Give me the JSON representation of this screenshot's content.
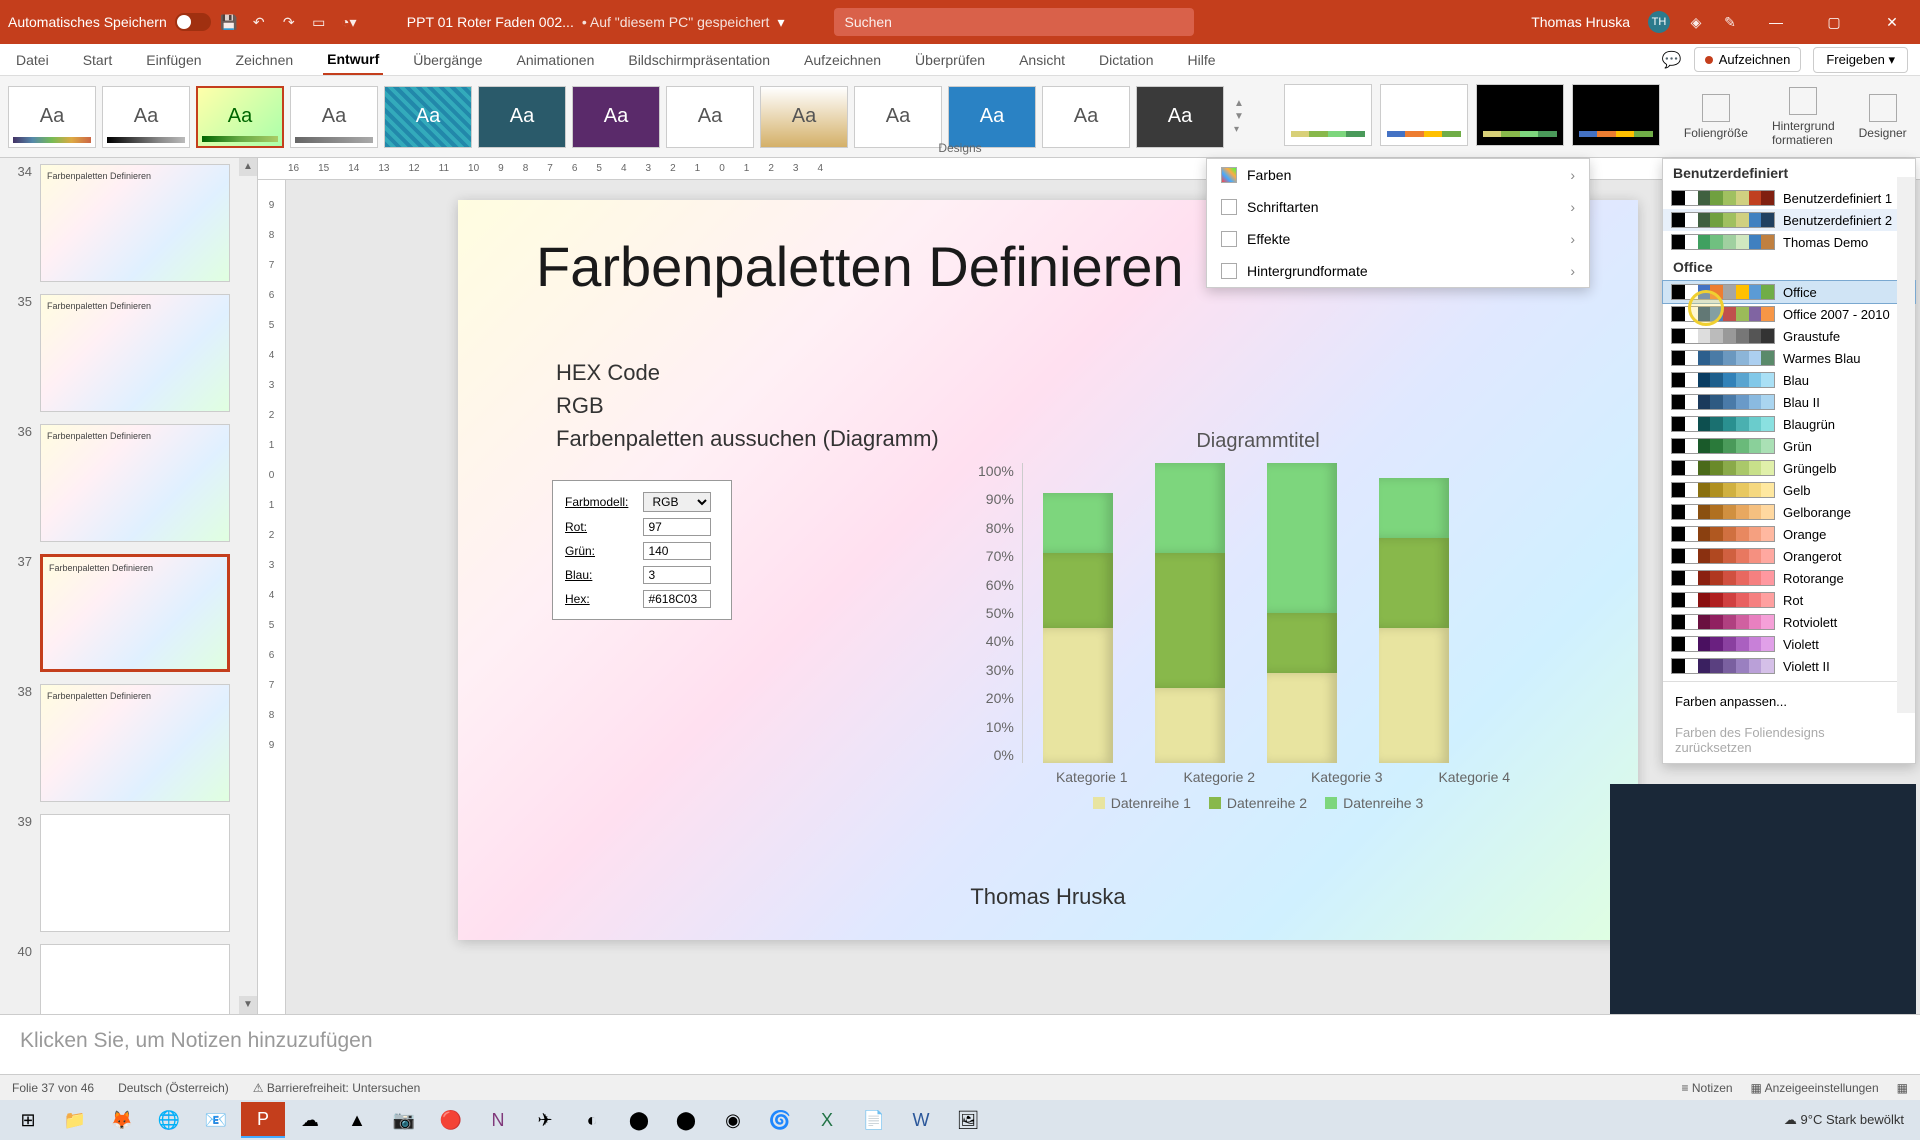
{
  "titlebar": {
    "autosave": "Automatisches Speichern",
    "filename": "PPT 01 Roter Faden 002...",
    "saved_location": "• Auf \"diesem PC\" gespeichert",
    "search_placeholder": "Suchen",
    "user": "Thomas Hruska",
    "initials": "TH"
  },
  "ribbon_tabs": [
    "Datei",
    "Start",
    "Einfügen",
    "Zeichnen",
    "Entwurf",
    "Übergänge",
    "Animationen",
    "Bildschirmpräsentation",
    "Aufzeichnen",
    "Überprüfen",
    "Ansicht",
    "Dictation",
    "Hilfe"
  ],
  "ribbon_active": "Entwurf",
  "ribbon_actions": {
    "record": "Aufzeichnen",
    "share": "Freigeben"
  },
  "designs_label": "Designs",
  "ribbon_right": {
    "slide_size": "Foliengröße",
    "format_bg": "Hintergrund formatieren",
    "designer": "Designer"
  },
  "variant_menu": {
    "colors": "Farben",
    "fonts": "Schriftarten",
    "effects": "Effekte",
    "bg_formats": "Hintergrundformate"
  },
  "colors_flyout": {
    "custom_header": "Benutzerdefiniert",
    "custom": [
      "Benutzerdefiniert 1",
      "Benutzerdefiniert 2",
      "Thomas Demo"
    ],
    "office_header": "Office",
    "office": [
      "Office",
      "Office 2007 - 2010",
      "Graustufe",
      "Warmes Blau",
      "Blau",
      "Blau II",
      "Blaugrün",
      "Grün",
      "Grüngelb",
      "Gelb",
      "Gelborange",
      "Orange",
      "Orangerot",
      "Rotorange",
      "Rot",
      "Rotviolett",
      "Violett",
      "Violett II"
    ],
    "customize": "Farben anpassen...",
    "reset": "Farben des Foliendesigns zurücksetzen"
  },
  "thumbnails": [
    34,
    35,
    36,
    37,
    38,
    39,
    40
  ],
  "thumb_selected": 37,
  "thumb_title": "Farbenpaletten Definieren",
  "ruler_h": [
    16,
    15,
    14,
    13,
    12,
    11,
    10,
    9,
    8,
    7,
    6,
    5,
    4,
    3,
    2,
    1,
    0,
    1,
    2,
    3,
    4
  ],
  "ruler_v": [
    9,
    8,
    7,
    6,
    5,
    4,
    3,
    2,
    1,
    0,
    1,
    2,
    3,
    4,
    5,
    6,
    7,
    8,
    9
  ],
  "slide": {
    "title": "Farbenpaletten Definieren",
    "bullets": [
      "HEX Code",
      "RGB",
      "Farbenpaletten aussuchen (Diagramm)"
    ],
    "author": "Thomas Hruska",
    "colorbox": {
      "model_label": "Farbmodell:",
      "model": "RGB",
      "rot_lbl": "Rot:",
      "rot": "97",
      "gruen_lbl": "Grün:",
      "gruen": "140",
      "blau_lbl": "Blau:",
      "blau": "3",
      "hex_lbl": "Hex:",
      "hex": "#618C03"
    }
  },
  "chart_data": {
    "type": "bar",
    "title": "Diagrammtitel",
    "categories": [
      "Kategorie 1",
      "Kategorie 2",
      "Kategorie 3",
      "Kategorie 4"
    ],
    "series": [
      {
        "name": "Datenreihe 1",
        "values": [
          45,
          25,
          30,
          45
        ],
        "color": "#e8e4a0"
      },
      {
        "name": "Datenreihe 2",
        "values": [
          25,
          45,
          20,
          30
        ],
        "color": "#88b84b"
      },
      {
        "name": "Datenreihe 3",
        "values": [
          20,
          30,
          50,
          20
        ],
        "color": "#7dd67d"
      }
    ],
    "ylabels": [
      "100%",
      "90%",
      "80%",
      "70%",
      "60%",
      "50%",
      "40%",
      "30%",
      "20%",
      "10%",
      "0%"
    ],
    "ylim": [
      0,
      100
    ]
  },
  "notes_placeholder": "Klicken Sie, um Notizen hinzuzufügen",
  "statusbar": {
    "slide": "Folie 37 von 46",
    "lang": "Deutsch (Österreich)",
    "access": "Barrierefreiheit: Untersuchen",
    "notes": "Notizen",
    "display": "Anzeigeeinstellungen"
  },
  "taskbar": {
    "weather": "9°C  Stark bewölkt"
  },
  "color_swatches": {
    "Benutzerdefiniert 1": [
      "#000",
      "#fff",
      "#406040",
      "#70a040",
      "#a0c060",
      "#d0d080",
      "#c04020",
      "#802010"
    ],
    "Benutzerdefiniert 2": [
      "#000",
      "#fff",
      "#406040",
      "#70a040",
      "#a0c060",
      "#d0d080",
      "#4080c0",
      "#204060"
    ],
    "Thomas Demo": [
      "#000",
      "#fff",
      "#40a060",
      "#70c080",
      "#a0d0a0",
      "#d0e8c0",
      "#4080c0",
      "#c08040"
    ],
    "Office": [
      "#000",
      "#fff",
      "#4472c4",
      "#ed7d31",
      "#a5a5a5",
      "#ffc000",
      "#5b9bd5",
      "#70ad47"
    ],
    "Office 2007 - 2010": [
      "#000",
      "#fff",
      "#1f497d",
      "#4f81bd",
      "#c0504d",
      "#9bbb59",
      "#8064a2",
      "#f79646"
    ],
    "Graustufe": [
      "#000",
      "#fff",
      "#ddd",
      "#bbb",
      "#999",
      "#777",
      "#555",
      "#333"
    ],
    "Warmes Blau": [
      "#000",
      "#fff",
      "#2c5f8d",
      "#4a7ba6",
      "#6b98bf",
      "#8cb5d8",
      "#accff0",
      "#5a8a6a"
    ],
    "Blau": [
      "#000",
      "#fff",
      "#0a3d62",
      "#1e5f8c",
      "#3282b8",
      "#5aa5d0",
      "#82c8e8",
      "#aae0f5"
    ],
    "Blau II": [
      "#000",
      "#fff",
      "#1b3a5c",
      "#2e5a82",
      "#4a7aa8",
      "#6a9ac8",
      "#8abae0",
      "#aad5f0"
    ],
    "Blaugrün": [
      "#000",
      "#fff",
      "#0d4f4f",
      "#1a7070",
      "#2a9090",
      "#4ab0b0",
      "#6acccc",
      "#8ae0e0"
    ],
    "Grün": [
      "#000",
      "#fff",
      "#1a5a2a",
      "#2a7a3a",
      "#4a9a5a",
      "#6aba7a",
      "#8ad09a",
      "#aae0b5"
    ],
    "Grüngelb": [
      "#000",
      "#fff",
      "#4a6a1a",
      "#6a8a2a",
      "#8aaa4a",
      "#aac86a",
      "#c8e08a",
      "#e0f0aa"
    ],
    "Gelb": [
      "#000",
      "#fff",
      "#8a7010",
      "#b09020",
      "#d0b040",
      "#e8c860",
      "#f5d880",
      "#ffe8a0"
    ],
    "Gelborange": [
      "#000",
      "#fff",
      "#8a5010",
      "#b07020",
      "#d09040",
      "#e8a860",
      "#f5c080",
      "#ffd8a0"
    ],
    "Orange": [
      "#000",
      "#fff",
      "#8a4010",
      "#b05820",
      "#d07040",
      "#e88860",
      "#f5a080",
      "#ffb8a0"
    ],
    "Orangerot": [
      "#000",
      "#fff",
      "#8a3010",
      "#b04820",
      "#d06040",
      "#e87860",
      "#f59080",
      "#ffa8a0"
    ],
    "Rotorange": [
      "#000",
      "#fff",
      "#8a2010",
      "#b03820",
      "#d05040",
      "#e86860",
      "#f58080",
      "#ff98a0"
    ],
    "Rot": [
      "#000",
      "#fff",
      "#8a1010",
      "#b02020",
      "#d04040",
      "#e86060",
      "#f58080",
      "#ffa0a0"
    ],
    "Rotviolett": [
      "#000",
      "#fff",
      "#6a1040",
      "#902060",
      "#b04080",
      "#d060a0",
      "#e880c0",
      "#f5a0d8"
    ],
    "Violett": [
      "#000",
      "#fff",
      "#4a1060",
      "#6a2080",
      "#8a40a0",
      "#aa60c0",
      "#c880d8",
      "#e0a0e8"
    ],
    "Violett II": [
      "#000",
      "#fff",
      "#3a2060",
      "#5a4080",
      "#7a60a0",
      "#9a80c0",
      "#baa0d8",
      "#d5c0e8"
    ]
  }
}
